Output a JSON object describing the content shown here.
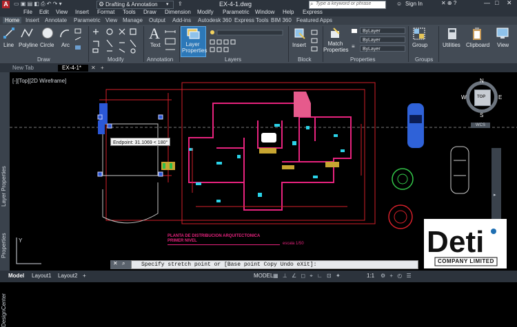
{
  "title_bar": {
    "workspace": "Drafting & Annotation",
    "doc_title": "EX-4-1.dwg",
    "search_placeholder": "Type a keyword or phrase",
    "sign_in": "Sign In"
  },
  "menu": [
    "File",
    "Edit",
    "View",
    "Insert",
    "Format",
    "Tools",
    "Draw",
    "Dimension",
    "Modify",
    "Parametric",
    "Window",
    "Help",
    "Express"
  ],
  "ribbon_tabs": [
    "Home",
    "Insert",
    "Annotate",
    "Parametric",
    "View",
    "Manage",
    "Output",
    "Add-ins",
    "Autodesk 360",
    "Express Tools",
    "BIM 360",
    "Featured Apps"
  ],
  "ribbon": {
    "draw_tools": [
      "Line",
      "Polyline",
      "Circle",
      "Arc"
    ],
    "text": "Text",
    "layer_properties": "Layer Properties",
    "insert": "Insert",
    "match_properties": "Match Properties",
    "bylayer": [
      "ByLayer",
      "ByLayer",
      "ByLayer"
    ],
    "group": "Group",
    "utilities": "Utilities",
    "clipboard": "Clipboard",
    "view": "View",
    "panels": [
      "Draw",
      "Modify",
      "Annotation",
      "Layers",
      "Block",
      "Properties",
      "Groups"
    ]
  },
  "doc_tabs": [
    "New Tab",
    "EX-4-1*"
  ],
  "viewport_label": "[-][Top][2D Wireframe]",
  "side_palettes": [
    "Layer Properties",
    "Properties",
    "DesignCenter"
  ],
  "viewcube": {
    "top": "TOP",
    "n": "N",
    "s": "S",
    "e": "E",
    "w": "W",
    "wcs": "WCS"
  },
  "snap_tooltip": "Endpoint: 31.1069 < 180°",
  "plan_title": "PLANTA DE DISTRIBUCION ARQUITECTONICA",
  "plan_subtitle": "PRIMER NIVEL",
  "plan_scale": "escala 1/50",
  "command": {
    "prompt": "Specify stretch point or",
    "options": "[Base point Copy Undo eXit]:"
  },
  "status": {
    "layout_tabs": [
      "Model",
      "Layout1",
      "Layout2"
    ],
    "model": "MODEL",
    "scale": "1:1"
  },
  "logo": {
    "name": "Deti",
    "company": "COMPANY LIMITED"
  },
  "colors": {
    "accent": "#1f6fb2",
    "ribbon": "#434b55",
    "titlebar": "#2c333c"
  }
}
